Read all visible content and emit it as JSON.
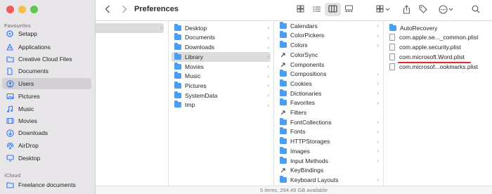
{
  "window": {
    "title": "Preferences",
    "traffic_colors": [
      "#ee5b5b",
      "#f5bf4f",
      "#61c454"
    ]
  },
  "sidebar": {
    "sections": [
      {
        "label": "Favourites"
      },
      {
        "label": "iCloud"
      }
    ],
    "items": [
      {
        "label": "Setapp",
        "icon": "setapp-icon"
      },
      {
        "label": "Applications",
        "icon": "applications-icon"
      },
      {
        "label": "Creative Cloud Files",
        "icon": "folder-icon"
      },
      {
        "label": "Documents",
        "icon": "document-icon"
      },
      {
        "label": "Users",
        "icon": "user-icon",
        "selected": true
      },
      {
        "label": "Pictures",
        "icon": "pictures-icon"
      },
      {
        "label": "Music",
        "icon": "music-icon"
      },
      {
        "label": "Movies",
        "icon": "movies-icon"
      },
      {
        "label": "Downloads",
        "icon": "downloads-icon"
      },
      {
        "label": "AirDrop",
        "icon": "airdrop-icon"
      },
      {
        "label": "Desktop",
        "icon": "desktop-icon"
      },
      {
        "label": "Freelance documents",
        "icon": "folder-icon"
      }
    ]
  },
  "toolbar": {
    "back_icon": "chevron-left-icon",
    "forward_icon": "chevron-right-icon",
    "view_icons": [
      "icon-view-icon",
      "list-view-icon",
      "column-view-icon",
      "gallery-view-icon"
    ],
    "group_icon": "group-icon",
    "share_icon": "share-icon",
    "tag_icon": "tag-icon",
    "more_icon": "more-icon",
    "search_icon": "search-icon"
  },
  "columns": {
    "user_folders": [
      {
        "label": "Desktop",
        "type": "folder"
      },
      {
        "label": "Documents",
        "type": "folder"
      },
      {
        "label": "Downloads",
        "type": "folder"
      },
      {
        "label": "Library",
        "type": "folder",
        "selected": true
      },
      {
        "label": "Movies",
        "type": "folder"
      },
      {
        "label": "Music",
        "type": "folder"
      },
      {
        "label": "Pictures",
        "type": "folder"
      },
      {
        "label": "SystemData",
        "type": "folder"
      },
      {
        "label": "tmp",
        "type": "folder"
      }
    ],
    "library_folders": [
      {
        "label": "Calendars",
        "type": "folder"
      },
      {
        "label": "ColorPickers",
        "type": "folder"
      },
      {
        "label": "Colors",
        "type": "folder"
      },
      {
        "label": "ColorSync",
        "type": "alias"
      },
      {
        "label": "Components",
        "type": "alias"
      },
      {
        "label": "Compositions",
        "type": "folder"
      },
      {
        "label": "Cookies",
        "type": "folder"
      },
      {
        "label": "Dictionaries",
        "type": "folder"
      },
      {
        "label": "Favorites",
        "type": "folder"
      },
      {
        "label": "Filters",
        "type": "alias"
      },
      {
        "label": "FontCollections",
        "type": "folder"
      },
      {
        "label": "Fonts",
        "type": "folder"
      },
      {
        "label": "HTTPStorages",
        "type": "folder"
      },
      {
        "label": "Images",
        "type": "folder"
      },
      {
        "label": "Input Methods",
        "type": "folder"
      },
      {
        "label": "KeyBindings",
        "type": "alias"
      },
      {
        "label": "Keyboard Layouts",
        "type": "folder"
      }
    ],
    "preferences_items": [
      {
        "label": "AutoRecovery",
        "type": "folder"
      },
      {
        "label": "com.apple.se..._common.plist",
        "type": "file"
      },
      {
        "label": "com.apple.security.plist",
        "type": "file"
      },
      {
        "label": "com.microsoft.Word.plist",
        "type": "file",
        "underlined": true
      },
      {
        "label": "com.microsof...ookmarks.plist",
        "type": "file"
      }
    ]
  },
  "status": {
    "text": "5 items, 294.49 GB available"
  },
  "colors": {
    "accent": "#3478f6",
    "folder": "#4a9ff5",
    "underline": "#e0292d"
  }
}
